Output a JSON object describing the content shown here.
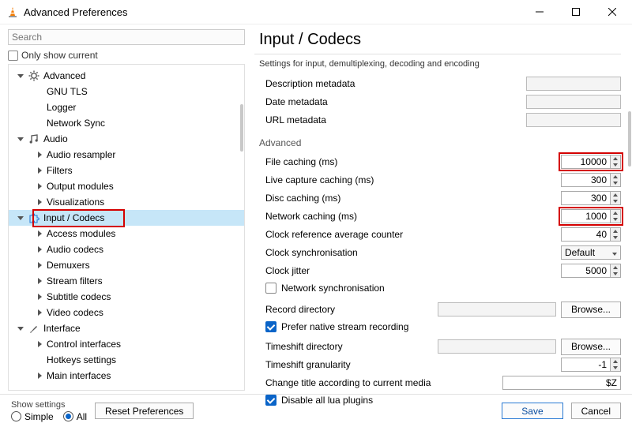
{
  "window": {
    "title": "Advanced Preferences"
  },
  "search": {
    "placeholder": "Search"
  },
  "only_show_current": {
    "label": "Only show current",
    "checked": false
  },
  "tree": {
    "advanced": {
      "label": "Advanced",
      "expanded": true,
      "children": [
        "GNU TLS",
        "Logger",
        "Network Sync"
      ]
    },
    "audio": {
      "label": "Audio",
      "expanded": true,
      "children": [
        "Audio resampler",
        "Filters",
        "Output modules",
        "Visualizations"
      ]
    },
    "input_codecs": {
      "label": "Input / Codecs",
      "expanded": true,
      "selected": true,
      "children": [
        "Access modules",
        "Audio codecs",
        "Demuxers",
        "Stream filters",
        "Subtitle codecs",
        "Video codecs"
      ]
    },
    "interface": {
      "label": "Interface",
      "expanded": true,
      "children": [
        "Control interfaces",
        "Hotkeys settings",
        "Main interfaces"
      ]
    }
  },
  "page": {
    "title": "Input / Codecs",
    "subtitle": "Settings for input, demultiplexing, decoding and encoding",
    "meta": {
      "desc_label": "Description metadata",
      "date_label": "Date metadata",
      "url_label": "URL metadata"
    },
    "advanced": {
      "group": "Advanced",
      "file_caching_label": "File caching (ms)",
      "file_caching": "10000",
      "live_caching_label": "Live capture caching (ms)",
      "live_caching": "300",
      "disc_caching_label": "Disc caching (ms)",
      "disc_caching": "300",
      "net_caching_label": "Network caching (ms)",
      "net_caching": "1000",
      "cr_avg_label": "Clock reference average counter",
      "cr_avg": "40",
      "clock_sync_label": "Clock synchronisation",
      "clock_sync": "Default",
      "clock_jitter_label": "Clock jitter",
      "clock_jitter": "5000",
      "net_sync_label": "Network synchronisation",
      "net_sync_checked": false,
      "record_dir_label": "Record directory",
      "record_dir": "",
      "browse_label": "Browse...",
      "prefer_native_label": "Prefer native stream recording",
      "prefer_native_checked": true,
      "timeshift_dir_label": "Timeshift directory",
      "timeshift_dir": "",
      "timeshift_gran_label": "Timeshift granularity",
      "timeshift_gran": "-1",
      "change_title_label": "Change title according to current media",
      "change_title": "$Z",
      "disable_lua_label": "Disable all lua plugins",
      "disable_lua_checked": true
    }
  },
  "footer": {
    "show_settings": "Show settings",
    "simple": "Simple",
    "all": "All",
    "reset": "Reset Preferences",
    "save": "Save",
    "cancel": "Cancel"
  }
}
